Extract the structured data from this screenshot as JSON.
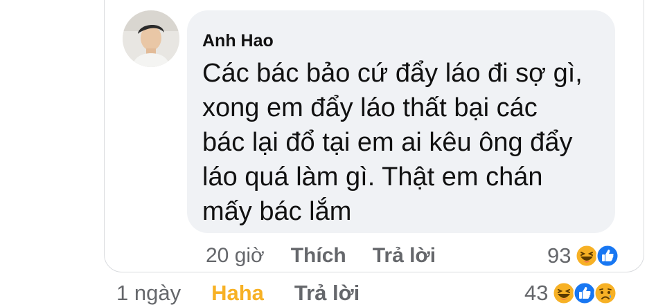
{
  "comment": {
    "author": "Anh Hao",
    "lines": [
      "Các bác bảo cứ đẩy láo đi sợ gì,",
      "xong em đẩy láo thất bại các",
      "bác lại đổ tại em ai kêu ông đẩy",
      "láo quá làm gì. Thật em chán",
      "mấy bác lắm"
    ],
    "time": "20 giờ",
    "like_label": "Thích",
    "reply_label": "Trả lời",
    "reaction_count": "93",
    "reaction_icons": [
      "haha-icon",
      "like-icon"
    ]
  },
  "post": {
    "time": "1 ngày",
    "reaction_label": "Haha",
    "reply_label": "Trả lời",
    "reaction_count": "43",
    "reaction_icons": [
      "haha-icon",
      "like-icon",
      "sad-icon"
    ]
  },
  "colors": {
    "bubble": "#f0f2f5",
    "meta_text": "#65676b",
    "haha_active": "#f7b125",
    "like_blue": "#1877f2"
  }
}
